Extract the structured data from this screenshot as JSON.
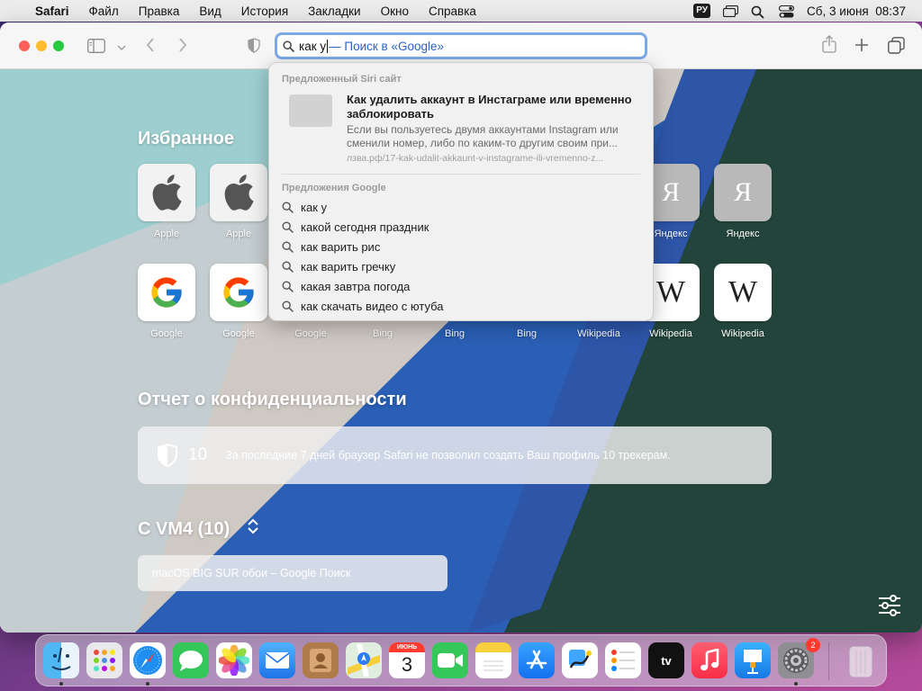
{
  "menubar": {
    "app": "Safari",
    "items": [
      "Файл",
      "Правка",
      "Вид",
      "История",
      "Закладки",
      "Окно",
      "Справка"
    ],
    "input_source": "РУ",
    "datetime": "Сб, 3 июня  08:37"
  },
  "toolbar": {
    "url_typed": "как у",
    "url_hint": "— Поиск в «Google»"
  },
  "start_page": {
    "favorites_title": "Избранное",
    "favorites_row1": [
      {
        "label": "Apple",
        "icon": "apple-logo"
      },
      {
        "label": "Apple",
        "icon": "apple-logo"
      },
      {
        "label": "Яндекс",
        "icon": "yandex-letter",
        "letter": "Я"
      },
      {
        "label": "Яндекс",
        "icon": "yandex-letter",
        "letter": "Я"
      }
    ],
    "favorites_row2": [
      {
        "label": "Google",
        "icon": "google-g"
      },
      {
        "label": "Google",
        "icon": "google-g"
      },
      {
        "label": "Google",
        "icon": "google-g"
      },
      {
        "label": "Bing",
        "icon": "bing"
      },
      {
        "label": "Bing",
        "icon": "bing"
      },
      {
        "label": "Bing",
        "icon": "bing"
      },
      {
        "label": "Wikipedia",
        "icon": "wikipedia-w",
        "letter": "W"
      },
      {
        "label": "Wikipedia",
        "icon": "wikipedia-w",
        "letter": "W"
      },
      {
        "label": "Wikipedia",
        "icon": "wikipedia-w",
        "letter": "W"
      }
    ],
    "privacy_title": "Отчет о конфиденциальности",
    "privacy_count": "10",
    "privacy_text": "За последние 7 дней браузер Safari не позволил создать Ваш профиль 10 трекерам.",
    "device_title": "С VM4 (10)",
    "device_item": "macOS BIG SUR обои – Google Поиск"
  },
  "dropdown": {
    "siri_header": "Предложенный Siri сайт",
    "siri_title": "Как удалить аккаунт в Инстаграме или временно заблокировать",
    "siri_desc": "Если вы пользуетесь двумя аккаунтами Instagram или сменили номер, либо по каким-то другим своим при...",
    "siri_url": "лзва.рф/17-kak-udalit-akkaunt-v-instagrame-ili-vremenno-z...",
    "google_header": "Предложения Google",
    "suggestions": [
      "как у",
      "какой сегодня праздник",
      "как варить рис",
      "как варить гречку",
      "какая завтра погода",
      "как скачать видео с ютуба"
    ]
  },
  "dock": {
    "calendar_month": "ИЮНЬ",
    "calendar_day": "3",
    "tv_label": "tv",
    "settings_badge": "2"
  },
  "colors": {
    "accent": "#7ea9e8",
    "link": "#2a63c9",
    "traffic_red": "#fe5f57",
    "traffic_yellow": "#febc2e",
    "traffic_green": "#28c840"
  }
}
